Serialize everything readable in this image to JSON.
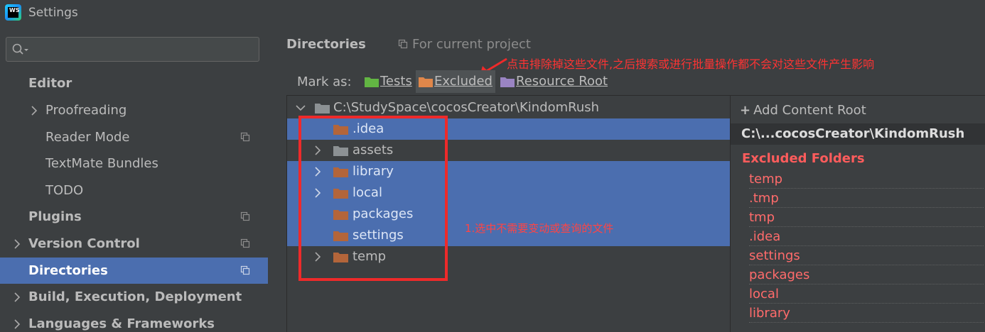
{
  "window": {
    "title": "Settings",
    "logo_text": "WS"
  },
  "sidebar": {
    "search": {
      "value": "",
      "placeholder": ""
    },
    "items": [
      {
        "label": "Editor"
      },
      {
        "label": "Proofreading"
      },
      {
        "label": "Reader Mode"
      },
      {
        "label": "TextMate Bundles"
      },
      {
        "label": "TODO"
      },
      {
        "label": "Plugins"
      },
      {
        "label": "Version Control"
      },
      {
        "label": "Directories"
      },
      {
        "label": "Build, Execution, Deployment"
      },
      {
        "label": "Languages & Frameworks"
      }
    ]
  },
  "main": {
    "title": "Directories",
    "scope": "For current project",
    "note_top": "点击排除掉这些文件,之后搜索或进行批量操作都不会对这些文件产生影响",
    "note_mid": "1.选中不需要变动或查询的文件",
    "mark_as": {
      "label": "Mark as:",
      "buttons": [
        {
          "label": "Tests",
          "color": "#62b543"
        },
        {
          "label": "Excluded",
          "color": "#e0874a"
        },
        {
          "label": "Resource Root",
          "color": "#9a84c3"
        }
      ]
    },
    "tree": {
      "root": "C:\\StudySpace\\cocosCreator\\KindomRush",
      "children": [
        {
          "name": ".idea"
        },
        {
          "name": "assets"
        },
        {
          "name": "library"
        },
        {
          "name": "local"
        },
        {
          "name": "packages"
        },
        {
          "name": "settings"
        },
        {
          "name": "temp"
        }
      ]
    },
    "content_root": {
      "add_label": "Add Content Root",
      "path": "C:\\...cocosCreator\\KindomRush",
      "excluded_title": "Excluded Folders",
      "excluded": [
        "temp",
        ".tmp",
        "tmp",
        ".idea",
        "settings",
        "packages",
        "local",
        "library"
      ]
    }
  },
  "colors": {
    "background": "#3c3f41",
    "selection": "#4b6eaf",
    "excluded_folder": "#b3653a",
    "plain_folder": "#8c9194",
    "annotation_red": "#ee2a2a"
  }
}
